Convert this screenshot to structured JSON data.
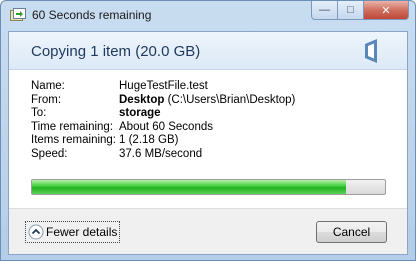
{
  "window": {
    "title": "60 Seconds remaining",
    "caption_buttons": {
      "minimize": "—",
      "maximize": "□",
      "close": "✕"
    }
  },
  "header": {
    "title": "Copying 1 item (20.0 GB)"
  },
  "details": {
    "name_label": "Name:",
    "name_value": "HugeTestFile.test",
    "from_label": "From:",
    "from_value_bold": "Desktop",
    "from_value_path": "(C:\\Users\\Brian\\Desktop)",
    "to_label": "To:",
    "to_value": "storage",
    "time_label": "Time remaining:",
    "time_value": "About 60 Seconds",
    "items_label": "Items remaining:",
    "items_value": "1 (2.18 GB)",
    "speed_label": "Speed:",
    "speed_value": "37.6 MB/second"
  },
  "progress": {
    "fraction": 0.89,
    "color": "#2fbf2f"
  },
  "footer": {
    "fewer_details_label": "Fewer details",
    "cancel_label": "Cancel"
  },
  "colors": {
    "header_text": "#1e395b",
    "frame": "#b4cde8"
  }
}
